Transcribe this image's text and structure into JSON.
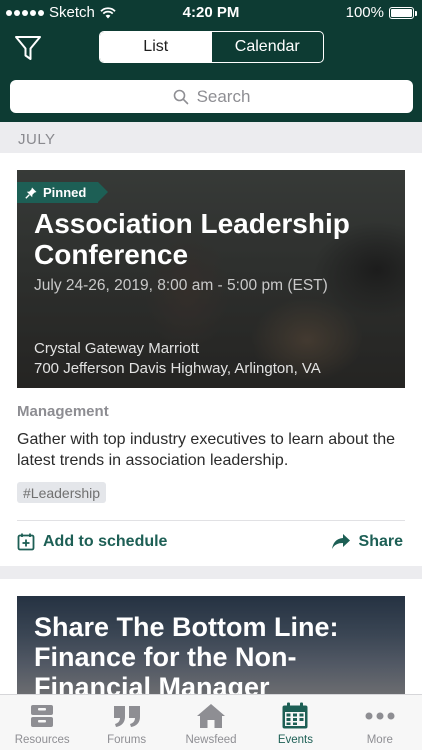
{
  "status_bar": {
    "carrier": "Sketch",
    "time": "4:20 PM",
    "battery": "100%"
  },
  "header": {
    "filter_icon": "filter-icon",
    "segments": [
      {
        "label": "List",
        "active": true
      },
      {
        "label": "Calendar",
        "active": false
      }
    ],
    "search": {
      "placeholder": "Search",
      "icon": "search-icon"
    }
  },
  "month": "JULY",
  "events": [
    {
      "pinned_label": "Pinned",
      "title": "Association Leadership Conference",
      "date": "July 24-26, 2019, 8:00 am - 5:00 pm (EST)",
      "venue_name": "Crystal Gateway Marriott",
      "venue_address": "700 Jefferson Davis Highway, Arlington, VA",
      "category": "Management",
      "description": "Gather with top industry executives to learn about the latest trends in association leadership.",
      "tag": "#Leadership",
      "add_label": "Add to schedule",
      "share_label": "Share"
    },
    {
      "title": "Share The Bottom Line: Finance for the Non-Financial Manager"
    }
  ],
  "tabbar": {
    "accent": "#1d5f55",
    "items": [
      {
        "label": "Resources",
        "icon": "archive-icon",
        "active": false
      },
      {
        "label": "Forums",
        "icon": "quote-icon",
        "active": false
      },
      {
        "label": "Newsfeed",
        "icon": "home-icon",
        "active": false
      },
      {
        "label": "Events",
        "icon": "calendar-icon",
        "active": true
      },
      {
        "label": "More",
        "icon": "more-icon",
        "active": false
      }
    ]
  }
}
